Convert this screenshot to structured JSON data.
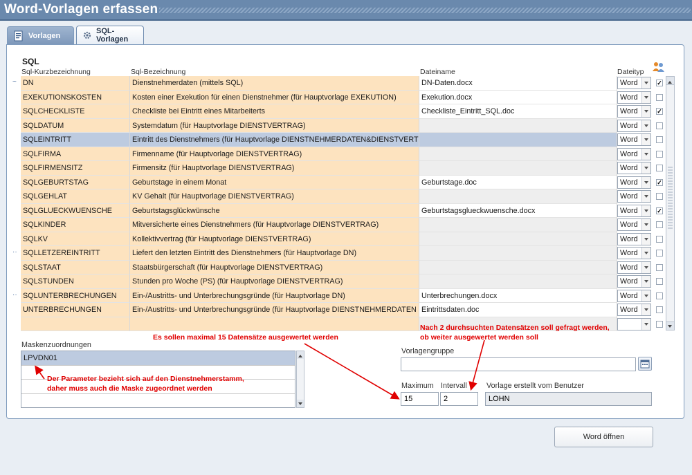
{
  "window": {
    "title": "Word-Vorlagen erfassen"
  },
  "tabs": [
    {
      "label": "Vorlagen",
      "icon": "word-document-icon"
    },
    {
      "label": "SQL-Vorlagen",
      "icon": "gear-icon"
    }
  ],
  "sql_section": {
    "title": "SQL",
    "columns": [
      "Sql-Kurzbezeichnung",
      "Sql-Bezeichnung",
      "Dateiname",
      "Dateityp"
    ],
    "rows": [
      {
        "kurz": "DN",
        "bez": "Dienstnehmerdaten (mittels SQL)",
        "file": "DN-Daten.docx",
        "type": "Word",
        "checked": "✓",
        "mark": "~"
      },
      {
        "kurz": "EXEKUTIONSKOSTEN",
        "bez": "Kosten einer Exekution für einen Dienstnehmer (für Hauptvorlage EXEKUTION)",
        "file": "Exekution.docx",
        "type": "Word",
        "checked": "",
        "mark": ""
      },
      {
        "kurz": "SQLCHECKLISTE",
        "bez": "Checkliste bei Eintritt eines Mitarbeiterts",
        "file": "Checkliste_Eintritt_SQL.doc",
        "type": "Word",
        "checked": "✓",
        "mark": ""
      },
      {
        "kurz": "SQLDATUM",
        "bez": "Systemdatum (für Hauptvorlage DIENSTVERTRAG)",
        "file": "",
        "type": "Word",
        "checked": "",
        "mark": ""
      },
      {
        "kurz": "SQLEINTRITT",
        "bez": "Eintritt des Dienstnehmers (für Hauptvorlage DIENSTNEHMERDATEN&DIENSTVERT",
        "file": "",
        "type": "Word",
        "checked": "",
        "mark": ""
      },
      {
        "kurz": "SQLFIRMA",
        "bez": "Firmenname (für Hauptvorlage DIENSTVERTRAG)",
        "file": "",
        "type": "Word",
        "checked": "",
        "mark": ""
      },
      {
        "kurz": "SQLFIRMENSITZ",
        "bez": "Firmensitz (für Hauptvorlage DIENSTVERTRAG)",
        "file": "",
        "type": "Word",
        "checked": "",
        "mark": ""
      },
      {
        "kurz": "SQLGEBURTSTAG",
        "bez": "Geburtstage in einem Monat",
        "file": "Geburtstage.doc",
        "type": "Word",
        "checked": "✓",
        "mark": ""
      },
      {
        "kurz": "SQLGEHLAT",
        "bez": "KV Gehalt (für Hauptvorlage DIENSTVERTRAG)",
        "file": "",
        "type": "Word",
        "checked": "",
        "mark": ""
      },
      {
        "kurz": "SQLGLUECKWUENSCHE",
        "bez": "Geburtstagsglückwünsche",
        "file": "Geburtstagsglueckwuensche.docx",
        "type": "Word",
        "checked": "✓",
        "mark": ""
      },
      {
        "kurz": "SQLKINDER",
        "bez": "Mitversicherte eines Dienstnehmers (für Hauptvorlage DIENSTVERTRAG)",
        "file": "",
        "type": "Word",
        "checked": "",
        "mark": ""
      },
      {
        "kurz": "SQLKV",
        "bez": "Kollektivvertrag (für Hauptvorlage DIENSTVERTRAG)",
        "file": "",
        "type": "Word",
        "checked": "",
        "mark": ""
      },
      {
        "kurz": "SQLLETZEREINTRITT",
        "bez": "Liefert den letzten Eintritt des Dienstnehmers (für Hauptvorlage DN)",
        "file": "",
        "type": "Word",
        "checked": "",
        "mark": "··"
      },
      {
        "kurz": "SQLSTAAT",
        "bez": "Staatsbürgerschaft (für Hauptvorlage DIENSTVERTRAG)",
        "file": "",
        "type": "Word",
        "checked": "",
        "mark": ""
      },
      {
        "kurz": "SQLSTUNDEN",
        "bez": "Stunden pro Woche (PS) (für Hauptvorlage DIENSTVERTRAG)",
        "file": "",
        "type": "Word",
        "checked": "",
        "mark": ""
      },
      {
        "kurz": "SQLUNTERBRECHUNGEN",
        "bez": "Ein-/Austritts- und Unterbrechungsgründe (für Hauptvorlage DN)",
        "file": "Unterbrechungen.docx",
        "type": "Word",
        "checked": "",
        "mark": "··"
      },
      {
        "kurz": "UNTERBRECHUNGEN",
        "bez": "Ein-/Austritts- und Unterbrechungsgründe (für Hauptvorlage DIENSTNEHMERDATEN",
        "file": "Eintrittsdaten.doc",
        "type": "Word",
        "checked": "",
        "mark": ""
      },
      {
        "kurz": "",
        "bez": "",
        "file": "",
        "type": "",
        "checked": "",
        "mark": ""
      }
    ],
    "selected_row": "SQLEINTRITT"
  },
  "masken": {
    "label": "Maskenzuordnungen",
    "items": [
      "LPVDN01",
      "",
      "",
      ""
    ]
  },
  "vorlagengruppe": {
    "label": "Vorlagengruppe",
    "value": ""
  },
  "maximum": {
    "label": "Maximum",
    "value": "15"
  },
  "intervall": {
    "label": "Intervall",
    "value": "2"
  },
  "erstellt": {
    "label": "Vorlage erstellt vom Benutzer",
    "value": "LOHN"
  },
  "annotations": {
    "max": "Es sollen maximal 15 Datensätze ausgewertet werden",
    "intervall_line1": "Nach 2 durchsuchten Datensätzen soll gefragt werden,",
    "intervall_line2": "ob weiter ausgewertet werden soll",
    "param_line1": "Der Parameter bezieht sich auf den Dienstnehmerstamm,",
    "param_line2": "daher muss auch die Maske zugeordnet werden"
  },
  "buttons": {
    "open_word": "Word öffnen"
  },
  "colors": {
    "titlebar": "#6a89ad",
    "row_bg": "#fde3bf",
    "selected": "#bdcbe0",
    "annotation": "#e00000"
  }
}
